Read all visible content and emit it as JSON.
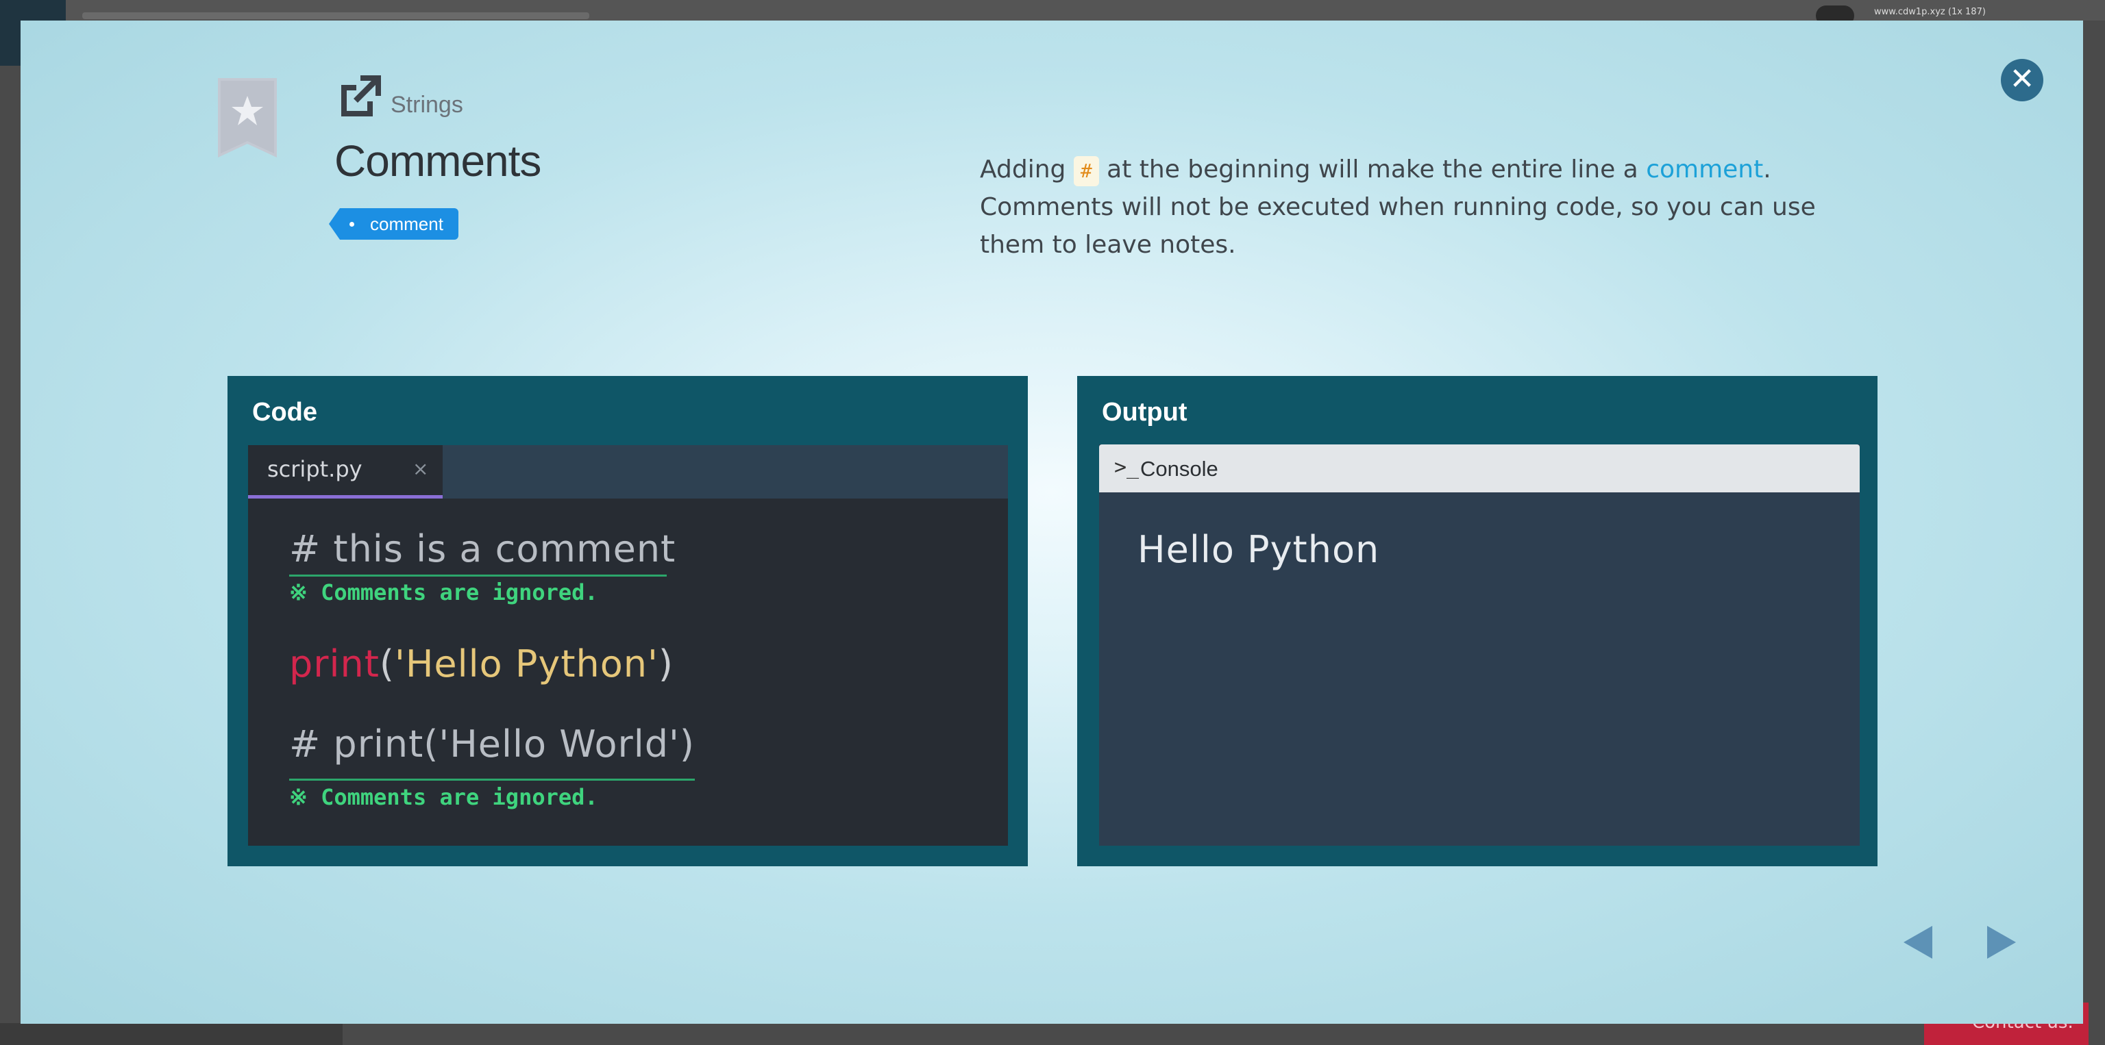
{
  "background": {
    "user_label": "www.cdw1p.xyz (1x 187)",
    "contact_label": "Contact us."
  },
  "lesson": {
    "category": "Strings",
    "title": "Comments",
    "tag": "comment",
    "description_parts": {
      "before": "Adding",
      "code": "#",
      "middle": "at the beginning will make the entire line a",
      "link": "comment",
      "after": ". Comments will not be executed when running code, so you can use them to leave notes."
    }
  },
  "code_panel": {
    "title": "Code",
    "tab_label": "script.py",
    "tab_close": "×",
    "line1": "# this is a comment",
    "note1": "Comments are ignored.",
    "line2_kw": "print",
    "line2_open": "(",
    "line2_str": "'Hello Python'",
    "line2_close": ")",
    "line3": "# print('Hello World')",
    "note2": "Comments are ignored.",
    "note_icon": "※"
  },
  "output_panel": {
    "title": "Output",
    "console_label": "Console",
    "console_icon": ">_",
    "output_text": "Hello Python"
  },
  "colors": {
    "panel_bg": "#0f5667",
    "accent_blue": "#1c8fe3",
    "comment_green": "#3fd47e",
    "keyword_red": "#d3264d",
    "string_yellow": "#e6c77a"
  }
}
